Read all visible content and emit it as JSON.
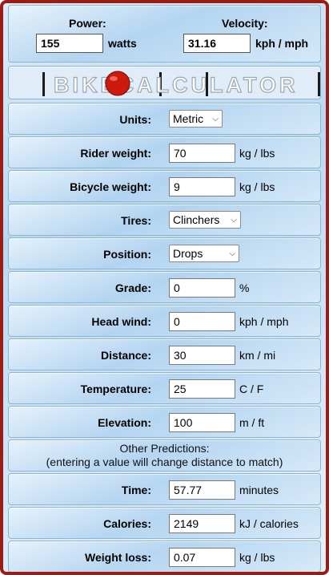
{
  "top": {
    "power_label": "Power:",
    "power_value": "155",
    "power_unit": "watts",
    "velocity_label": "Velocity:",
    "velocity_value": "31.16",
    "velocity_unit": "kph / mph"
  },
  "banner": {
    "logo_text": "BIKECALCULATOR"
  },
  "rows": {
    "units": {
      "label": "Units:",
      "value": "Metric"
    },
    "rider_weight": {
      "label": "Rider weight:",
      "value": "70",
      "unit": "kg / lbs"
    },
    "bicycle_weight": {
      "label": "Bicycle weight:",
      "value": "9",
      "unit": "kg / lbs"
    },
    "tires": {
      "label": "Tires:",
      "value": "Clinchers"
    },
    "position": {
      "label": "Position:",
      "value": "Drops"
    },
    "grade": {
      "label": "Grade:",
      "value": "0",
      "unit": "%"
    },
    "head_wind": {
      "label": "Head wind:",
      "value": "0",
      "unit": "kph / mph"
    },
    "distance": {
      "label": "Distance:",
      "value": "30",
      "unit": "km / mi"
    },
    "temperature": {
      "label": "Temperature:",
      "value": "25",
      "unit": "C / F"
    },
    "elevation": {
      "label": "Elevation:",
      "value": "100",
      "unit": "m / ft"
    }
  },
  "other": {
    "line1": "Other Predictions:",
    "line2": "(entering a value will change distance to match)"
  },
  "predictions": {
    "time": {
      "label": "Time:",
      "value": "57.77",
      "unit": "minutes"
    },
    "calories": {
      "label": "Calories:",
      "value": "2149",
      "unit": "kJ / calories"
    },
    "weight_loss": {
      "label": "Weight loss:",
      "value": "0.07",
      "unit": "kg / lbs"
    }
  },
  "colors": {
    "frame": "#9b1c14",
    "ball": "#cc1a0e"
  }
}
